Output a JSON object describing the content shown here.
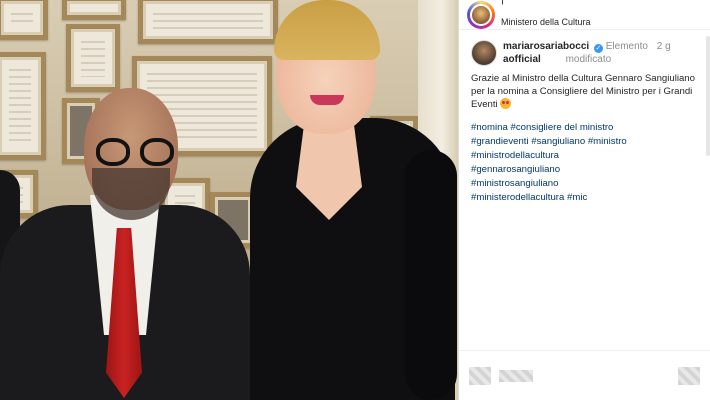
{
  "header": {
    "pipe": "|",
    "subtitle": "Ministero della Cultura"
  },
  "post": {
    "username_line1": "mariarosariabocci",
    "username_line2": "aofficial",
    "verified_icon": "verified-badge-icon",
    "edited_line1": "Elemento",
    "edited_line2": "modificato",
    "age": "2 g",
    "caption": "Grazie al Ministro della Cultura Gennaro Sangiuliano per la nomina a Consigliere del Ministro per i Grandi Eventi",
    "hashtags": [
      "#nomina",
      "#consigliere del ministro",
      "#grandieventi",
      "#sangiuliano",
      "#ministro",
      "#ministrodellacultura",
      "#gennarosangiuliano",
      "#ministrosangiuliano",
      "#ministerodellacultura",
      "#mic"
    ]
  },
  "colors": {
    "link": "#00376b",
    "verified": "#3897f0",
    "muted": "#8e8e8e"
  }
}
